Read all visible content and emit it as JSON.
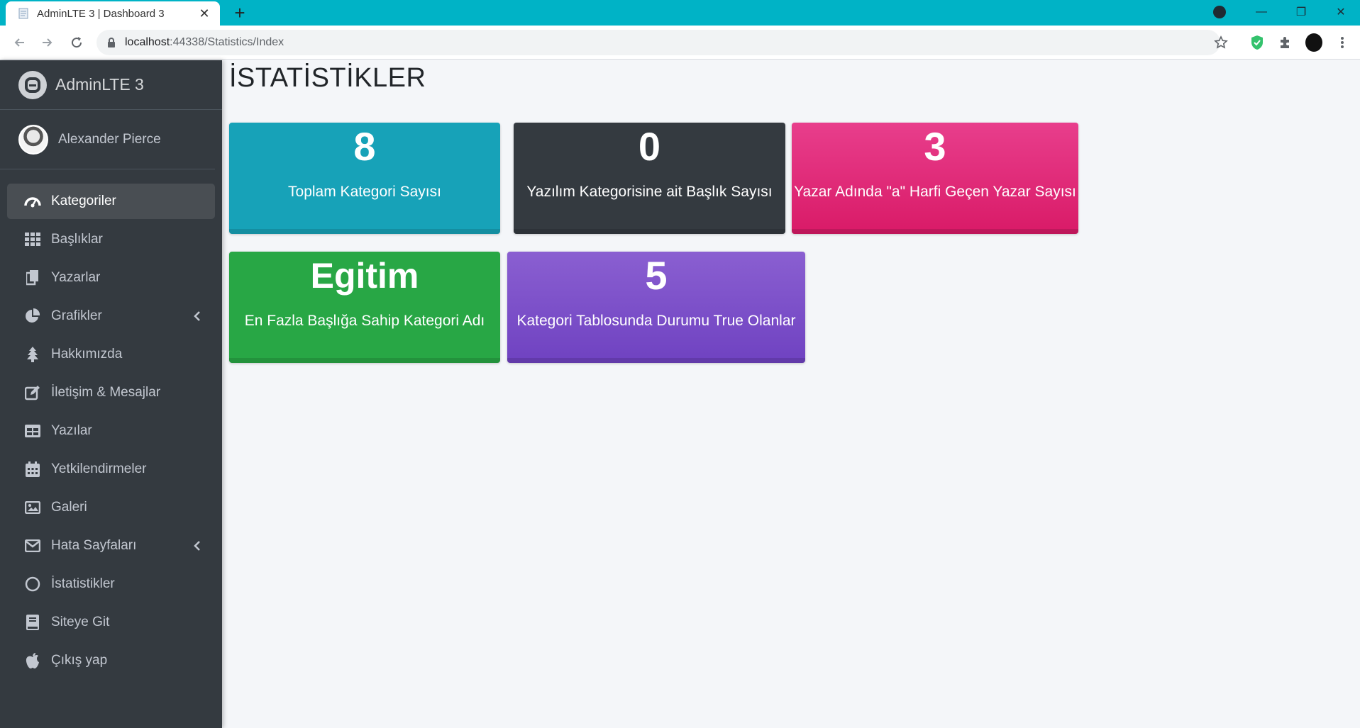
{
  "browser": {
    "tab_title": "AdminLTE 3 | Dashboard 3",
    "url_host": "localhost",
    "url_rest": ":44338/Statistics/Index",
    "accent": "#00b3c6"
  },
  "sidebar": {
    "brand": "AdminLTE 3",
    "user_name": "Alexander Pierce",
    "items": [
      {
        "label": "Kategoriler",
        "icon": "tachometer-icon",
        "active": true
      },
      {
        "label": "Başlıklar",
        "icon": "grid-icon"
      },
      {
        "label": "Yazarlar",
        "icon": "copy-icon"
      },
      {
        "label": "Grafikler",
        "icon": "pie-chart-icon",
        "expandable": true
      },
      {
        "label": "Hakkımızda",
        "icon": "tree-icon"
      },
      {
        "label": "İletişim & Mesajlar",
        "icon": "edit-icon"
      },
      {
        "label": "Yazılar",
        "icon": "table-icon"
      },
      {
        "label": "Yetkilendirmeler",
        "icon": "calendar-icon"
      },
      {
        "label": "Galeri",
        "icon": "image-icon"
      },
      {
        "label": "Hata Sayfaları",
        "icon": "envelope-icon",
        "expandable": true
      },
      {
        "label": "İstatistikler",
        "icon": "circle-icon"
      },
      {
        "label": "Siteye Git",
        "icon": "book-icon"
      },
      {
        "label": "Çıkış yap",
        "icon": "apple-icon"
      }
    ]
  },
  "main": {
    "title": "İSTATİSTİKLER",
    "boxes": [
      {
        "value": "8",
        "label": "Toplam Kategori Sayısı",
        "color": "#17a2b8"
      },
      {
        "value": "0",
        "label": "Yazılım Kategorisine ait Başlık Sayısı",
        "color": "#343a40"
      },
      {
        "value": "3",
        "label": "Yazar Adında \"a\" Harfi Geçen Yazar Sayısı",
        "color": "#e83e8c"
      },
      {
        "value": "Egitim",
        "label": "En Fazla Başlığa Sahip Kategori Adı",
        "color": "#28a745"
      },
      {
        "value": "5",
        "label": "Kategori Tablosunda Durumu True Olanlar",
        "color": "#6f42c1"
      }
    ]
  }
}
